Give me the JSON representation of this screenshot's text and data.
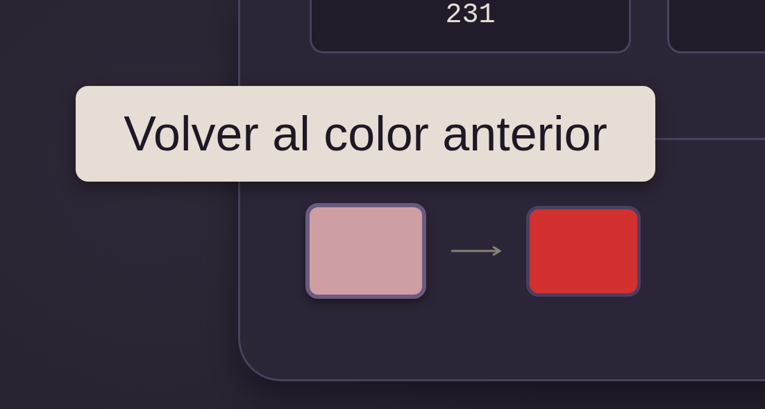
{
  "readout": {
    "value": "231"
  },
  "swatches": [
    {
      "kind": "previous",
      "color": "#cf9ea2"
    },
    {
      "kind": "current",
      "color": "#d33030"
    }
  ],
  "tooltip": {
    "text": "Volver al color anterior"
  }
}
